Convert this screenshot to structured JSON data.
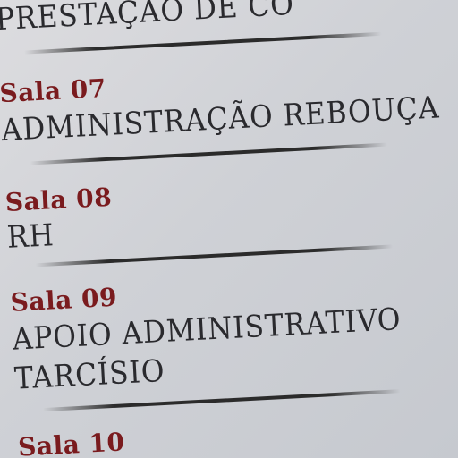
{
  "top_heading": "PRESTAÇÃO DE CO",
  "entries": [
    {
      "room": "Sala 07",
      "lines": [
        "ADMINISTRAÇÃO REBOUÇA"
      ]
    },
    {
      "room": "Sala 08",
      "lines": [
        "RH"
      ]
    },
    {
      "room": "Sala 09",
      "lines": [
        "APOIO ADMINISTRATIVO",
        "TARCÍSIO"
      ]
    },
    {
      "room": "Sala 10",
      "lines": []
    }
  ],
  "colors": {
    "room_label": "#7a1b1e",
    "department_text": "#2a2a2e",
    "divider": "#2b2b2b",
    "background": "#cfd1d6"
  }
}
